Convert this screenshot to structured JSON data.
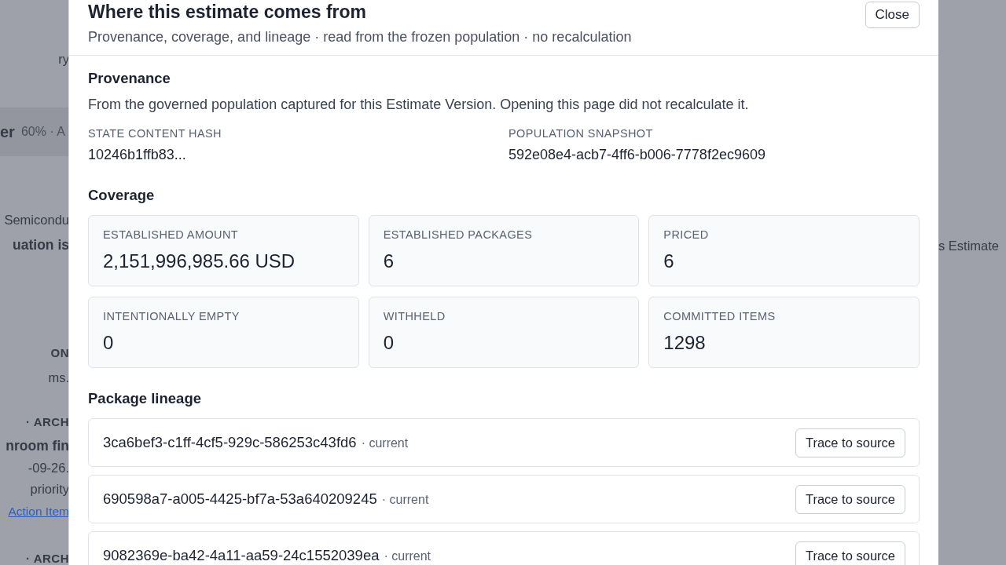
{
  "backdrop": {
    "left": [
      {
        "text": "ry",
        "kind": "plain"
      },
      {
        "text": "er",
        "kind": "band-title",
        "extra": "60% · A"
      },
      {
        "text": "Semicondu",
        "kind": "plain"
      },
      {
        "text": "uation is",
        "kind": "title"
      },
      {
        "text": "ON",
        "kind": "caps"
      },
      {
        "text": "ms.",
        "kind": "plain"
      },
      {
        "text": "· ARCH",
        "kind": "caps"
      },
      {
        "text": "nroom fin",
        "kind": "title"
      },
      {
        "text": "-09-26.",
        "kind": "plain"
      },
      {
        "text": "priority",
        "kind": "plain"
      },
      {
        "text": "Action Item",
        "kind": "link"
      },
      {
        "text": "· ARCH",
        "kind": "caps"
      }
    ],
    "right": [
      {
        "text": "s Estimate"
      }
    ]
  },
  "dialog": {
    "title": "Where this estimate comes from",
    "subtitle": "Provenance, coverage, and lineage · read from the frozen population · no recalculation",
    "close": "Close",
    "provenance": {
      "heading": "Provenance",
      "text": "From the governed population captured for this Estimate Version. Opening this page did not recalculate it.",
      "fields": [
        {
          "label": "STATE CONTENT HASH",
          "value": "10246b1ffb83..."
        },
        {
          "label": "POPULATION SNAPSHOT",
          "value": "592e08e4-acb7-4ff6-b006-7778f2ec9609"
        }
      ]
    },
    "coverage": {
      "heading": "Coverage",
      "cards": [
        {
          "label": "ESTABLISHED AMOUNT",
          "value": "2,151,996,985.66 USD"
        },
        {
          "label": "ESTABLISHED PACKAGES",
          "value": "6"
        },
        {
          "label": "PRICED",
          "value": "6"
        },
        {
          "label": "INTENTIONALLY EMPTY",
          "value": "0"
        },
        {
          "label": "WITHHELD",
          "value": "0"
        },
        {
          "label": "COMMITTED ITEMS",
          "value": "1298"
        }
      ]
    },
    "lineage": {
      "heading": "Package lineage",
      "rows": [
        {
          "id": "3ca6bef3-c1ff-4cf5-929c-586253c43fd6",
          "status": "· current",
          "action": "Trace to source"
        },
        {
          "id": "690598a7-a005-4425-bf7a-53a640209245",
          "status": "· current",
          "action": "Trace to source"
        },
        {
          "id": "9082369e-ba42-4a11-aa59-24c1552039ea",
          "status": "· current",
          "action": "Trace to source"
        }
      ]
    }
  }
}
